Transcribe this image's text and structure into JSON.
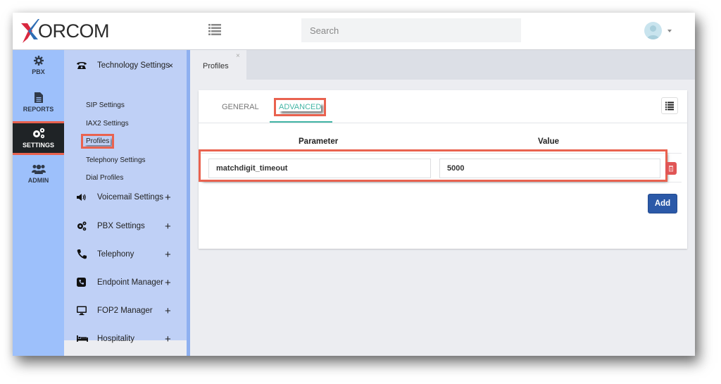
{
  "header": {
    "logo_text": "ORCOM",
    "logo_brand": "Xorcom",
    "search_placeholder": "Search",
    "menu_icon": "list-icon",
    "avatar_icon": "user-avatar-icon"
  },
  "nav": {
    "items": [
      {
        "label": "PBX",
        "icon": "gear-icon",
        "active": false
      },
      {
        "label": "REPORTS",
        "icon": "document-icon",
        "active": false
      },
      {
        "label": "SETTINGS",
        "icon": "gears-icon",
        "active": true
      },
      {
        "label": "ADMIN",
        "icon": "users-icon",
        "active": false
      }
    ]
  },
  "subnav": {
    "sections": [
      {
        "label": "Technology Settings",
        "icon": "phone-desk-icon",
        "action": "×",
        "expanded": true,
        "children": [
          {
            "label": "SIP Settings",
            "active": false
          },
          {
            "label": "IAX2 Settings",
            "active": false
          },
          {
            "label": "Profiles",
            "active": true
          },
          {
            "label": "Telephony Settings",
            "active": false
          },
          {
            "label": "Dial Profiles",
            "active": false
          }
        ]
      },
      {
        "label": "Voicemail Settings",
        "icon": "volume-icon",
        "action": "+"
      },
      {
        "label": "PBX Settings",
        "icon": "gears-icon",
        "action": "+"
      },
      {
        "label": "Telephony",
        "icon": "phone-icon",
        "action": "+"
      },
      {
        "label": "Endpoint Manager",
        "icon": "phone-square-icon",
        "action": "+"
      },
      {
        "label": "FOP2 Manager",
        "icon": "monitor-icon",
        "action": "+"
      },
      {
        "label": "Hospitality",
        "icon": "bed-icon",
        "action": "+"
      }
    ]
  },
  "page_tabs": [
    {
      "label": "Profiles",
      "close": "×"
    }
  ],
  "card": {
    "tabs": [
      {
        "label": "GENERAL",
        "active": false
      },
      {
        "label": "ADVANCED",
        "active": true
      }
    ],
    "columns": [
      "Parameter",
      "Value"
    ],
    "rows": [
      {
        "parameter": "matchdigit_timeout",
        "value": "5000"
      }
    ],
    "add_label": "Add"
  },
  "colors": {
    "accent_teal": "#43b5a5",
    "highlight_red": "#e9624f",
    "add_blue": "#2b59a8",
    "delete_red": "#e05555",
    "nav_blue": "#9dc0fb",
    "subnav_blue": "#bfd0f6"
  }
}
